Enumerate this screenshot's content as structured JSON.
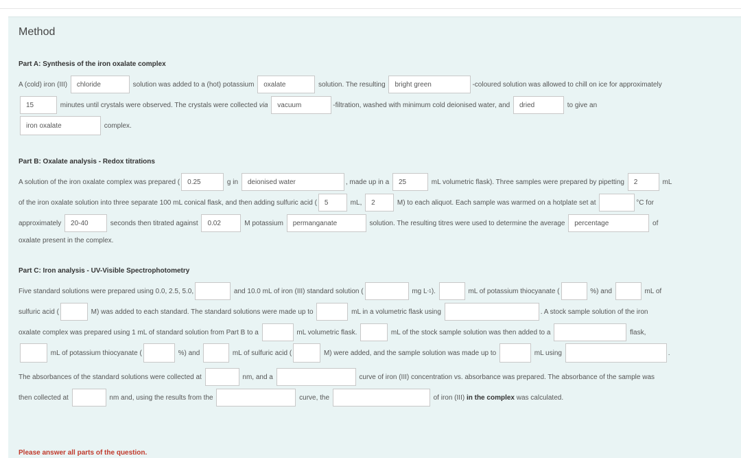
{
  "title": "Method",
  "partA": {
    "heading": "Part A: Synthesis of the iron oxalate complex",
    "t1": "A (cold) iron (III) ",
    "in1": "chloride",
    "t2": " solution was added to a (hot) potassium ",
    "in2": "oxalate",
    "t3": " solution. The resulting ",
    "in3": "bright green",
    "t4": "-coloured solution was allowed to chill on ice for approximately",
    "in4": "15",
    "t5": " minutes until crystals were observed. The crystals were collected ",
    "t5b": "via",
    "in5": "vacuum",
    "t6": "-filtration, washed with minimum cold deionised water, and ",
    "in6": "dried",
    "t7": " to give an",
    "in7": "iron oxalate",
    "t8": " complex."
  },
  "partB": {
    "heading": "Part B: Oxalate analysis - Redox titrations",
    "t1": "A solution of the iron oxalate complex was prepared (",
    "in1": "0.25",
    "t2": " g in ",
    "in2": "deionised water",
    "t3": ", made up in a ",
    "in3": "25",
    "t4": " mL volumetric flask). Three samples were prepared by pipetting ",
    "in4": "2",
    "t5": " mL",
    "t6": "of the iron oxalate solution into three separate 100 mL conical flask, and then adding sulfuric acid (",
    "in5": "5",
    "t7": " mL, ",
    "in6": "2",
    "t8": " M) to each aliquot. Each sample was warmed on a hotplate set at ",
    "in7": "",
    "t9": "°C for",
    "t10": "approximately ",
    "in8": "20-40",
    "t11": " seconds then titrated against ",
    "in9": "0.02",
    "t12": " M potassium ",
    "in10": "permanganate",
    "t13": " solution. The resulting titres were used to determine the average ",
    "in11": "percentage",
    "t14": " of",
    "t15": "oxalate present in the complex."
  },
  "partC": {
    "heading": "Part C: Iron analysis - UV-Visible Spectrophotometry",
    "l1a": "Five standard solutions were prepared using 0.0, 2.5, 5.0,",
    "l1b": " and 10.0 mL of iron (III) standard solution (",
    "l1c": " mg L",
    "l1sup": "-1",
    "l1d": "). ",
    "l1e": " mL of potassium thiocyanate (",
    "l1f": " %) and ",
    "l1g": " mL of",
    "l2a": "sulfuric acid (",
    "l2b": " M) was added to each standard. The standard solutions were made up to ",
    "l2c": " mL in a volumetric flask using ",
    "l2d": ". A stock sample solution of the iron",
    "l3a": "oxalate complex was prepared using 1 mL of standard solution from Part B to a ",
    "l3b": " mL volumetric flask. ",
    "l3c": " mL of the stock sample solution was then added to a ",
    "l3d": " flask,",
    "l4a": " mL of potassium thiocyanate (",
    "l4b": " %) and ",
    "l4c": " mL of sulfuric acid (",
    "l4d": " M) were added, and the sample solution was made up to ",
    "l4e": " mL using ",
    "l4f": ".",
    "l5a": "The absorbances of the standard solutions were collected at ",
    "l5b": " nm, and a ",
    "l5c": " curve of iron (III) concentration vs. absorbance was prepared. The absorbance of the sample was",
    "l6a": "then collected at ",
    "l6b": " nm and, using the results from the ",
    "l6c": " curve, the ",
    "l6d": " of iron (III) ",
    "l6e": "in the complex",
    "l6f": " was calculated."
  },
  "error": "Please answer all parts of the question.",
  "colors": {
    "panel": "#e9f4f4",
    "error": "#c0392b",
    "input_border": "#c8c8c8"
  }
}
